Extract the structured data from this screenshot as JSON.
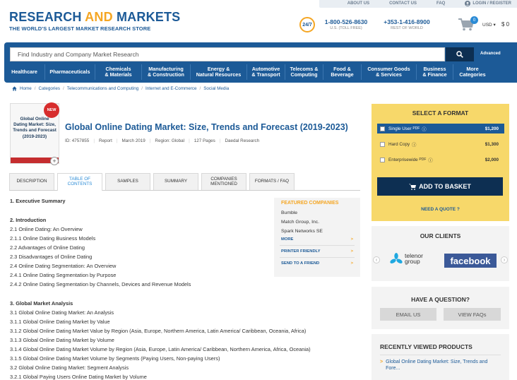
{
  "top_links": {
    "about": "ABOUT US",
    "contact": "CONTACT US",
    "faq": "FAQ",
    "login": "LOGIN / REGISTER"
  },
  "logo": {
    "word1": "RESEARCH",
    "word2": "AND",
    "word3": "MARKETS",
    "tagline": "THE WORLD'S LARGEST MARKET RESEARCH STORE"
  },
  "support": {
    "badge": "24/7",
    "phone1": "1-800-526-8630",
    "phone1_sub": "U.S. (TOLL FREE)",
    "phone2": "+353-1-416-8900",
    "phone2_sub": "REST OF WORLD"
  },
  "cart": {
    "count": "0",
    "currency": "USD ▾",
    "total": "$ 0"
  },
  "search": {
    "placeholder": "Find Industry and Company Market Research",
    "advanced": "Advanced"
  },
  "categories": [
    {
      "l1": "Healthcare",
      "l2": ""
    },
    {
      "l1": "Pharmaceuticals",
      "l2": ""
    },
    {
      "l1": "Chemicals",
      "l2": "& Materials"
    },
    {
      "l1": "Manufacturing",
      "l2": "& Construction"
    },
    {
      "l1": "Energy &",
      "l2": "Natural Resources"
    },
    {
      "l1": "Automotive",
      "l2": "& Transport"
    },
    {
      "l1": "Telecoms &",
      "l2": "Computing"
    },
    {
      "l1": "Food &",
      "l2": "Beverage"
    },
    {
      "l1": "Consumer Goods",
      "l2": "& Services"
    },
    {
      "l1": "Business",
      "l2": "& Finance"
    },
    {
      "l1": "More",
      "l2": "Categories"
    }
  ],
  "breadcrumb": [
    "Home",
    "Categories",
    "Telecommunications and Computing",
    "Internet and E-Commerce",
    "Social Media"
  ],
  "product": {
    "thumb_title": "Global Online Dating Market: Size, Trends and Forecast (2019-2023)",
    "badge": "NEW",
    "title": "Global Online Dating Market: Size, Trends and Forecast (2019-2023)",
    "id": "ID: 4757855",
    "type": "Report",
    "date": "March 2019",
    "region": "Region: Global",
    "pages": "127 Pages",
    "publisher": "Daedal Research"
  },
  "tabs": [
    {
      "l1": "DESCRIPTION",
      "l2": ""
    },
    {
      "l1": "TABLE OF",
      "l2": "CONTENTS"
    },
    {
      "l1": "SAMPLES",
      "l2": ""
    },
    {
      "l1": "SUMMARY",
      "l2": ""
    },
    {
      "l1": "COMPANIES",
      "l2": "MENTIONED"
    },
    {
      "l1": "FORMATS / FAQ",
      "l2": ""
    }
  ],
  "toc": [
    "1. Executive Summary",
    "2. Introduction",
    "2.1 Online Dating: An Overview",
    "2.1.1 Online Dating Business Models",
    "2.2 Advantages of Online Dating",
    "2.3 Disadvantages of Online Dating",
    "2.4 Online Dating Segmentation: An Overview",
    "2.4.1 Online Dating Segmentation by Purpose",
    "2.4.2 Online Dating Segmentation by Channels, Devices and Revenue Models",
    "3. Global Market Analysis",
    "3.1 Global Online Dating Market: An Analysis",
    "3.1.1 Global Online Dating Market by Value",
    "3.1.2 Global Online Dating Market Value by Region (Asia, Europe, Northern America, Latin America/ Caribbean, Oceania, Africa)",
    "3.1.3 Global Online Dating Market by Volume",
    "3.1.4 Global Online Dating Market Volume by Region (Asia, Europe, Latin America/ Caribbean, Northern America, Africa, Oceania)",
    "3.1.5 Global Online Dating Market Volume by Segments (Paying Users, Non-paying Users)",
    "3.2 Global Online Dating Market: Segment Analysis",
    "3.2.1 Global Paying Users Online Dating Market by Volume"
  ],
  "featured": {
    "heading": "FEATURED COMPANIES",
    "companies": [
      "Bumble",
      "Match Group, Inc.",
      "Spark Networks SE"
    ],
    "more": "MORE",
    "printer": "PRINTER FRIENDLY",
    "send": "SEND TO A FRIEND"
  },
  "format": {
    "heading": "SELECT A FORMAT",
    "options": [
      {
        "label": "Single User",
        "sub": "PDF",
        "price": "$1,200"
      },
      {
        "label": "Hard Copy",
        "sub": "",
        "price": "$1,300"
      },
      {
        "label": "Enterprisewide",
        "sub": "PDF",
        "price": "$2,000"
      }
    ],
    "add_basket": "ADD TO BASKET",
    "quote": "NEED A QUOTE ?"
  },
  "clients": {
    "heading": "OUR CLIENTS",
    "telenor1": "telenor",
    "telenor2": "group",
    "facebook": "facebook"
  },
  "question": {
    "heading": "HAVE A QUESTION?",
    "email": "EMAIL US",
    "faqs": "VIEW FAQs"
  },
  "recent": {
    "heading": "RECENTLY VIEWED PRODUCTS",
    "item": "Global Online Dating Market: Size, Trends and Fore..."
  },
  "colors": {
    "brand_blue": "#1c5a97",
    "accent_orange": "#f5a623",
    "format_yellow": "#f7d86a",
    "dark_navy": "#0d2f52"
  }
}
